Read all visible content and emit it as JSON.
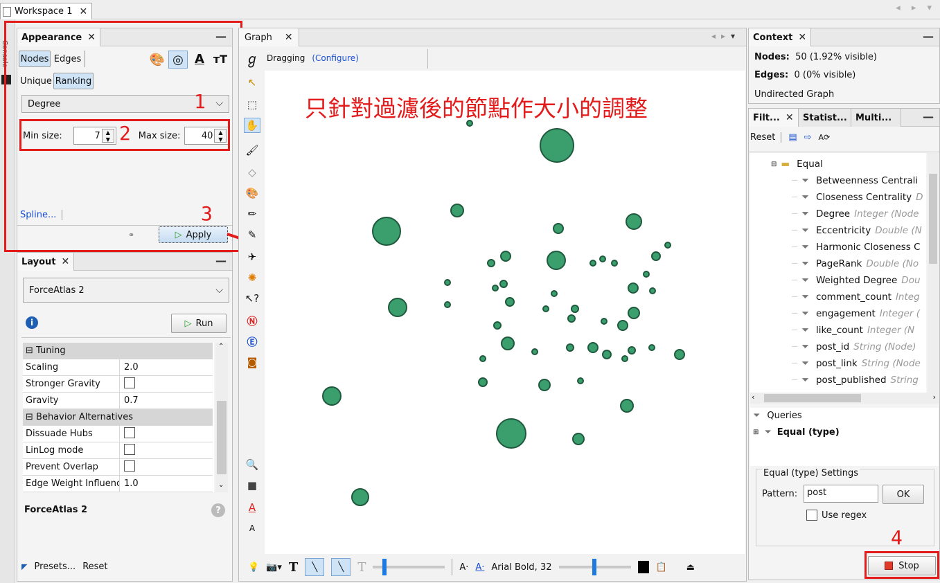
{
  "top_tab": {
    "label": "Workspace 1",
    "close": "✕"
  },
  "left_strip_label": "Console",
  "appearance": {
    "title": "Appearance",
    "close": "✕",
    "min": "—",
    "tabs": [
      "Nodes",
      "Edges"
    ],
    "modes": [
      "Unique",
      "Ranking"
    ],
    "attribute": "Degree",
    "min_size_label": "Min size:",
    "min_size_value": "7",
    "max_size_label": "Max size:",
    "max_size_value": "40",
    "spline_label": "Spline...",
    "apply_label": "Apply",
    "icon_a": "A",
    "icon_tt": "ᴛT"
  },
  "annotations": {
    "n1": "1",
    "n2": "2",
    "n3": "3",
    "n4": "4",
    "chinese_caption": "只針對過濾後的節點作大小的調整"
  },
  "layout": {
    "title": "Layout",
    "close": "✕",
    "min": "—",
    "algorithm": "ForceAtlas 2",
    "run_label": "Run",
    "rows": [
      {
        "key": "Tuning",
        "value": "",
        "category": true
      },
      {
        "key": "Scaling",
        "value": "2.0"
      },
      {
        "key": "Stronger Gravity",
        "value": "",
        "checkbox": true
      },
      {
        "key": "Gravity",
        "value": "0.7"
      },
      {
        "key": "Behavior Alternatives",
        "value": "",
        "category": true
      },
      {
        "key": "Dissuade Hubs",
        "value": "",
        "checkbox": true
      },
      {
        "key": "LinLog mode",
        "value": "",
        "checkbox": true
      },
      {
        "key": "Prevent Overlap",
        "value": "",
        "checkbox": true
      },
      {
        "key": "Edge Weight Influence",
        "value": "1.0"
      }
    ],
    "desc_title": "ForceAtlas 2",
    "presets_label": "Presets...",
    "reset_label": "Reset"
  },
  "graph": {
    "title": "Graph",
    "close": "✕",
    "mode_label": "Dragging",
    "configure_label": "(Configure)",
    "font_label": "Arial Bold, 32",
    "node_color": "#3a9e6d"
  },
  "context": {
    "title": "Context",
    "close": "✕",
    "min": "—",
    "nodes_label": "Nodes:",
    "nodes_value": "50 (1.92% visible)",
    "edges_label": "Edges:",
    "edges_value": "0 (0% visible)",
    "graph_type": "Undirected Graph"
  },
  "filters": {
    "tabs": [
      "Filt...",
      "Statist...",
      "Multi..."
    ],
    "close": "✕",
    "min": "—",
    "reset_label": "Reset",
    "folder": "Equal",
    "items": [
      {
        "name": "Betweenness Centrali",
        "type": ""
      },
      {
        "name": "Closeness Centrality",
        "type": "D"
      },
      {
        "name": "Degree",
        "type": "Integer (Node"
      },
      {
        "name": "Eccentricity",
        "type": "Double (N"
      },
      {
        "name": "Harmonic Closeness C",
        "type": ""
      },
      {
        "name": "PageRank",
        "type": "Double (No"
      },
      {
        "name": "Weighted Degree",
        "type": "Dou"
      },
      {
        "name": "comment_count",
        "type": "Integ"
      },
      {
        "name": "engagement",
        "type": "Integer ("
      },
      {
        "name": "like_count",
        "type": "Integer (N"
      },
      {
        "name": "post_id",
        "type": "String (Node)"
      },
      {
        "name": "post_link",
        "type": "String (Node"
      },
      {
        "name": "post_published",
        "type": "String"
      }
    ],
    "queries_label": "Queries",
    "query_item": "Equal (type)",
    "settings_title": "Equal (type) Settings",
    "pattern_label": "Pattern:",
    "pattern_value": "post",
    "ok_label": "OK",
    "regex_label": "Use regex",
    "stop_label": "Stop"
  }
}
